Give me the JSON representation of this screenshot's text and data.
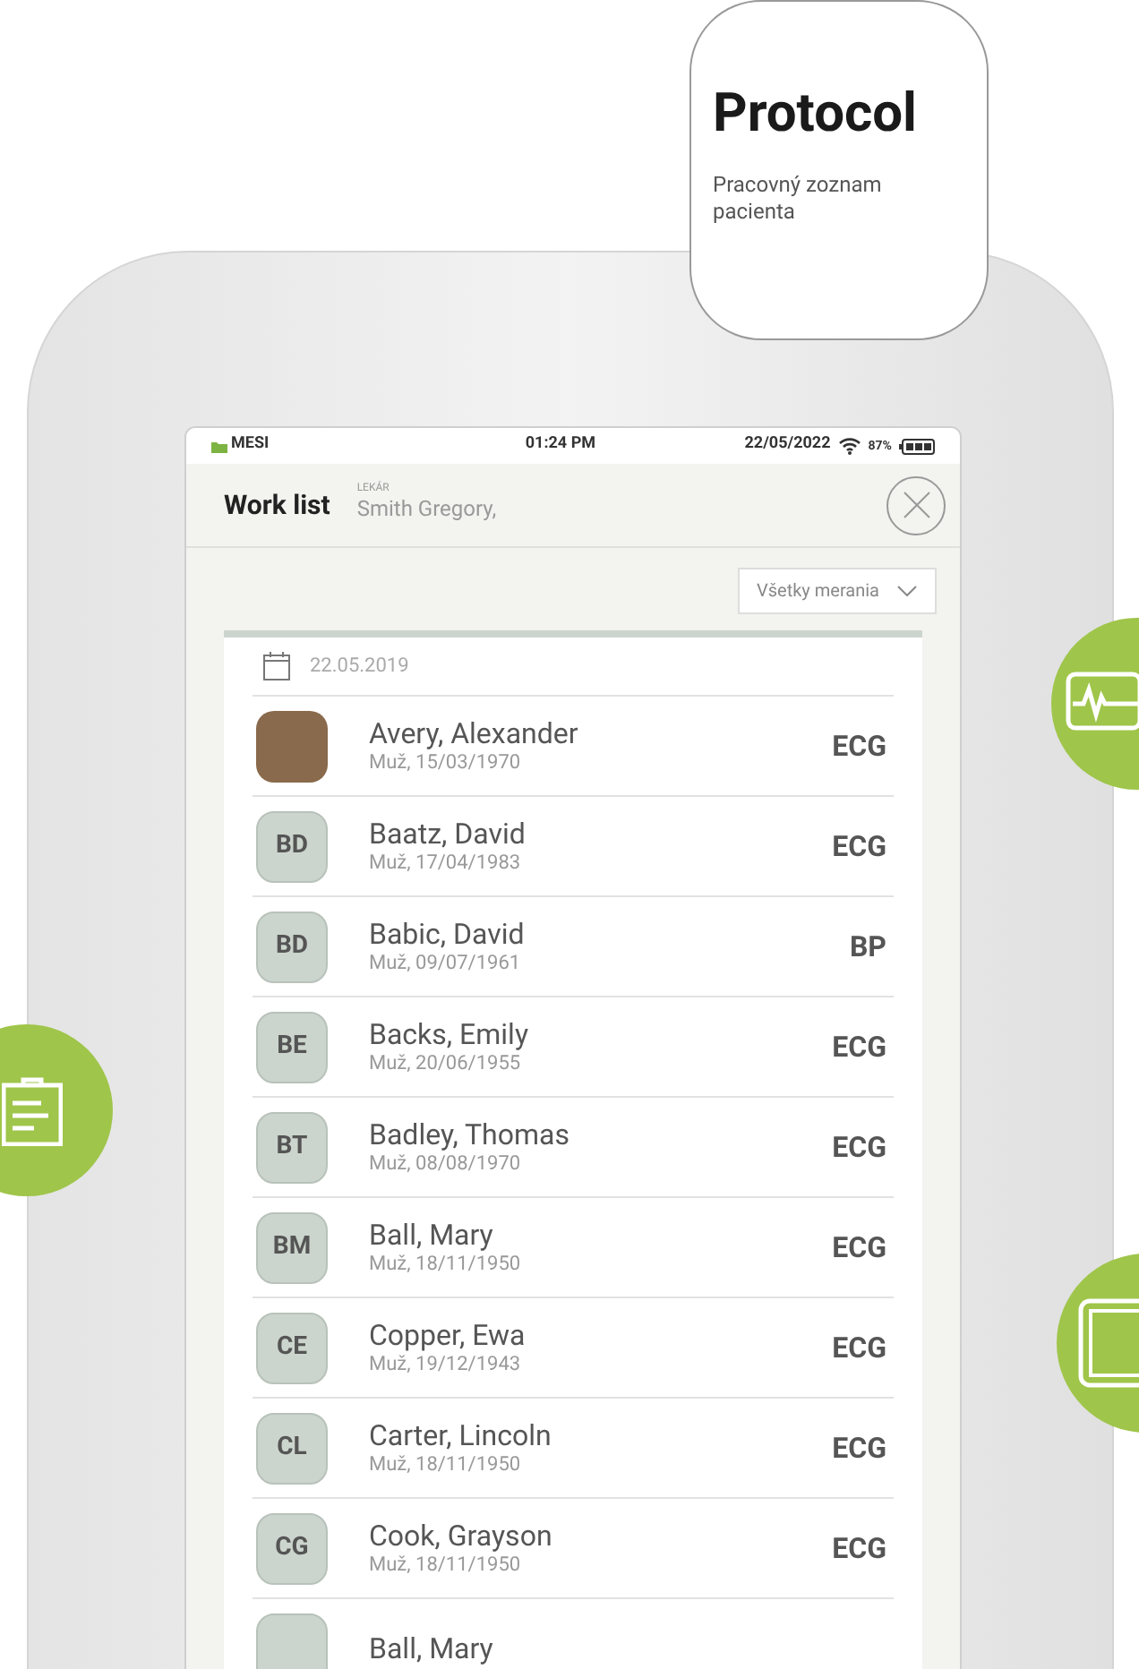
{
  "callout": {
    "title": "Protocol",
    "subtitle": "Pracovný zoznam pacienta"
  },
  "status_bar": {
    "carrier": "MESI",
    "time": "01:24 PM",
    "date": "22/05/2022",
    "battery": "87%"
  },
  "header": {
    "title": "Work list",
    "role_label": "LEKÁR",
    "doctor": "Smith Gregory,"
  },
  "filter": {
    "value": "Všetky merania"
  },
  "list": {
    "date": "22.05.2019",
    "rows": [
      {
        "kind": "photo",
        "name": "Avery, Alexander",
        "details": "Muž, 15/03/1970",
        "measurement": "ECG"
      },
      {
        "kind": "initials",
        "initials": "BD",
        "name": "Baatz, David",
        "details": "Muž, 17/04/1983",
        "measurement": "ECG"
      },
      {
        "kind": "initials",
        "initials": "BD",
        "name": "Babic, David",
        "details": "Muž, 09/07/1961",
        "measurement": "BP"
      },
      {
        "kind": "initials",
        "initials": "BE",
        "name": "Backs, Emily",
        "details": "Muž, 20/06/1955",
        "measurement": "ECG"
      },
      {
        "kind": "initials",
        "initials": "BT",
        "name": "Badley, Thomas",
        "details": "Muž, 08/08/1970",
        "measurement": "ECG"
      },
      {
        "kind": "initials",
        "initials": "BM",
        "name": "Ball, Mary",
        "details": "Muž, 18/11/1950",
        "measurement": "ECG"
      },
      {
        "kind": "initials",
        "initials": "CE",
        "name": "Copper, Ewa",
        "details": "Muž, 19/12/1943",
        "measurement": "ECG"
      },
      {
        "kind": "initials",
        "initials": "CL",
        "name": "Carter, Lincoln",
        "details": "Muž, 18/11/1950",
        "measurement": "ECG"
      },
      {
        "kind": "initials",
        "initials": "CG",
        "name": "Cook, Grayson",
        "details": "Muž, 18/11/1950",
        "measurement": "ECG"
      },
      {
        "kind": "initials",
        "name": "Ball, Mary"
      }
    ]
  }
}
